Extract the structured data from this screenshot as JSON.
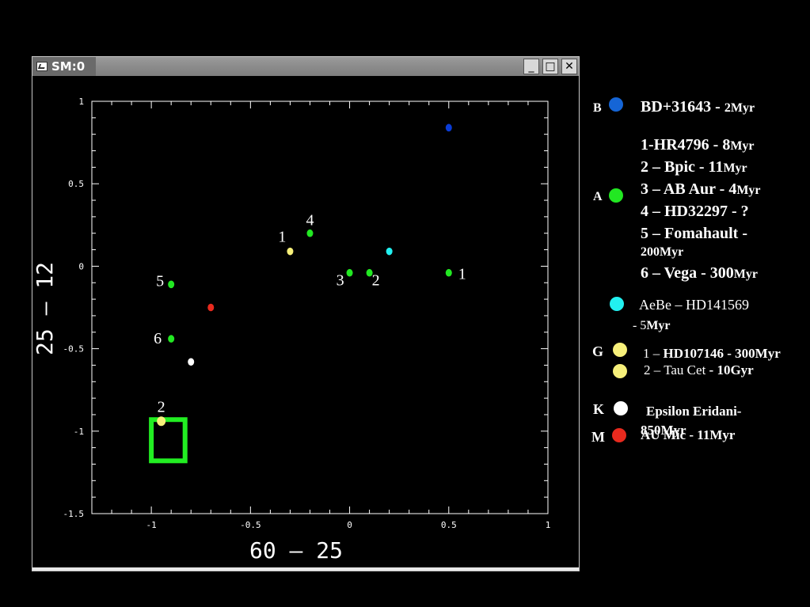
{
  "window": {
    "title": "SM:0",
    "buttons": {
      "minimize": "_",
      "maximize": "□",
      "close": "✕"
    }
  },
  "colors": {
    "blue": "#0a3cd6",
    "green": "#22e822",
    "cyan": "#22f0f0",
    "yellow": "#f7f07a",
    "white": "#ffffff",
    "red": "#e82a1e",
    "box": "#22ee22",
    "legend_blue": "#1565d6"
  },
  "chart_data": {
    "type": "scatter",
    "xlabel": "60 – 25",
    "ylabel": "25 – 12",
    "xlim": [
      -1.3,
      1.0
    ],
    "ylim": [
      -1.5,
      1.0
    ],
    "x_ticks": [
      "-1",
      "-0.5",
      "0",
      "0.5",
      "1"
    ],
    "y_ticks": [
      "1",
      "0.5",
      "0",
      "-0.5",
      "-1",
      "-1.5"
    ],
    "points": [
      {
        "x": 0.5,
        "y": 0.84,
        "color": "blue",
        "label": ""
      },
      {
        "x": -0.2,
        "y": 0.2,
        "color": "green",
        "label": "4"
      },
      {
        "x": -0.3,
        "y": 0.09,
        "color": "yellow",
        "label": "1"
      },
      {
        "x": 0.2,
        "y": 0.09,
        "color": "cyan",
        "label": ""
      },
      {
        "x": 0.0,
        "y": -0.04,
        "color": "green",
        "label": "3"
      },
      {
        "x": 0.1,
        "y": -0.04,
        "color": "green",
        "label": "2"
      },
      {
        "x": 0.5,
        "y": -0.04,
        "color": "green",
        "label": "1"
      },
      {
        "x": -0.9,
        "y": -0.11,
        "color": "green",
        "label": "5"
      },
      {
        "x": -0.7,
        "y": -0.25,
        "color": "red",
        "label": ""
      },
      {
        "x": -0.9,
        "y": -0.44,
        "color": "green",
        "label": "6"
      },
      {
        "x": -0.8,
        "y": -0.58,
        "color": "white",
        "label": ""
      },
      {
        "x": -0.95,
        "y": -0.94,
        "color": "yellow",
        "label": "2"
      }
    ],
    "highlight_box": {
      "x0": -1.0,
      "x1": -0.83,
      "y0": -1.18,
      "y1": -0.93
    }
  },
  "legend": {
    "B": {
      "class": "B",
      "name": "BD+31643 - ",
      "age": "2Myr"
    },
    "A": {
      "class": "A",
      "items": [
        {
          "name": "1-HR4796 - 8",
          "age": "Myr"
        },
        {
          "name": "2 – Bpic - 11",
          "age": "Myr"
        },
        {
          "name": "3 – AB Aur - 4",
          "age": "Myr"
        },
        {
          "name": "4 – HD32297 - ?",
          "age": ""
        },
        {
          "name": "5 – Fomahault -",
          "age": ""
        },
        {
          "name": "",
          "age": "200Myr"
        },
        {
          "name": "6 – Vega - 300",
          "age": "Myr"
        }
      ]
    },
    "AeBe": {
      "name": "AeBe – HD141569",
      "line2_prefix": "- 5",
      "line2_age": "Myr"
    },
    "G": {
      "class": "G",
      "item1_prefix": "1 – ",
      "item1": "HD107146 - 300Myr",
      "item2_prefix": "2 – Tau Cet ",
      "item2": "- 10Gyr"
    },
    "K": {
      "class": "K",
      "name": "Epsilon  Eridani-",
      "age": "850Myr"
    },
    "M": {
      "class": "M",
      "name": "AU Mic - 11Myr"
    }
  }
}
